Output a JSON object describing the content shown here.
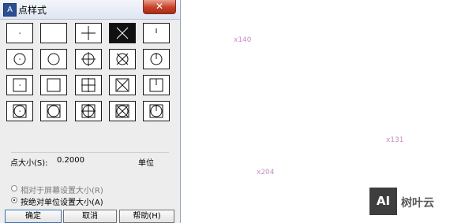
{
  "dialog": {
    "icon_glyph": "A",
    "title": "点样式",
    "close_glyph": "✕",
    "styles": [
      {
        "name": "point-style-dot",
        "symbol": "dot"
      },
      {
        "name": "point-style-none",
        "symbol": "none"
      },
      {
        "name": "point-style-plus",
        "symbol": "plus"
      },
      {
        "name": "point-style-x",
        "symbol": "x"
      },
      {
        "name": "point-style-tick",
        "symbol": "tick"
      },
      {
        "name": "point-style-circle-dot",
        "symbol": "circle-dot"
      },
      {
        "name": "point-style-circle",
        "symbol": "circle"
      },
      {
        "name": "point-style-circle-plus",
        "symbol": "circle-plus"
      },
      {
        "name": "point-style-circle-x",
        "symbol": "circle-x"
      },
      {
        "name": "point-style-circle-tick",
        "symbol": "circle-tick"
      },
      {
        "name": "point-style-square-dot",
        "symbol": "square-dot"
      },
      {
        "name": "point-style-square",
        "symbol": "square"
      },
      {
        "name": "point-style-square-plus",
        "symbol": "square-plus"
      },
      {
        "name": "point-style-square-x",
        "symbol": "square-x"
      },
      {
        "name": "point-style-square-tick",
        "symbol": "square-tick"
      },
      {
        "name": "point-style-square-circle-dot",
        "symbol": "square-circle-dot"
      },
      {
        "name": "point-style-square-circle",
        "symbol": "square-circle"
      },
      {
        "name": "point-style-square-circle-plus",
        "symbol": "square-circle-plus"
      },
      {
        "name": "point-style-square-circle-x",
        "symbol": "square-circle-x"
      },
      {
        "name": "point-style-square-circle-tick",
        "symbol": "square-circle-tick"
      }
    ],
    "selected_style": "x",
    "point_size_label": "点大小(S):",
    "point_size_value": "0.2000",
    "unit_label": "单位",
    "radio_relative": "相对于屏幕设置大小(R)",
    "radio_absolute": "按绝对单位设置大小(A)",
    "selected_radio": "absolute",
    "buttons": {
      "ok": "确定",
      "cancel": "取消",
      "help": "帮助(H)"
    }
  },
  "canvas": {
    "points": [
      {
        "label": "x140"
      },
      {
        "label": "x131"
      },
      {
        "label": "x204"
      }
    ],
    "point_color": "#c78fc7"
  },
  "watermark": {
    "logo_text": "AI",
    "brand_text": "树叶云"
  },
  "colors": {
    "selection": "#111111",
    "title_bg": "#e3e9f4",
    "close": "#c6412a"
  }
}
